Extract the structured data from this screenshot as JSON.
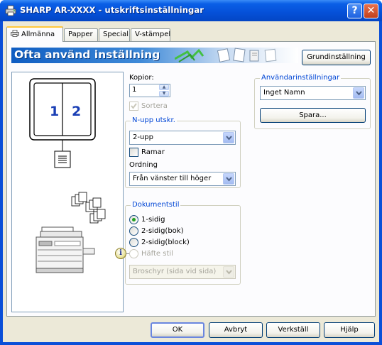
{
  "window": {
    "title": "SHARP AR-XXXX - utskriftsinställningar",
    "help_button": "?",
    "close_button": "✕"
  },
  "tabs": [
    {
      "label": "Allmänna",
      "active": true
    },
    {
      "label": "Papper",
      "active": false
    },
    {
      "label": "Special",
      "active": false
    },
    {
      "label": "V-stämpel",
      "active": false
    }
  ],
  "banner": {
    "title": "Ofta använd inställning"
  },
  "preview": {
    "page_numbers": [
      "1",
      "2"
    ]
  },
  "main": {
    "copies_label": "Kopior:",
    "copies_value": "1",
    "collate_label": "Sortera",
    "collate_checked": true,
    "collate_enabled": false
  },
  "nup": {
    "group_title": "N-upp utskr.",
    "selected": "2-upp",
    "border_label": "Ramar",
    "border_checked": false,
    "order_label": "Ordning",
    "order_selected": "Från vänster till höger"
  },
  "document_style": {
    "group_title": "Dokumentstil",
    "options": [
      {
        "label": "1-sidig",
        "selected": true,
        "enabled": true
      },
      {
        "label": "2-sidig(bok)",
        "selected": false,
        "enabled": true
      },
      {
        "label": "2-sidig(block)",
        "selected": false,
        "enabled": true
      },
      {
        "label": "Häfte stil",
        "selected": false,
        "enabled": false
      }
    ],
    "booklet_selected": "Broschyr (sida vid sida)"
  },
  "user_settings": {
    "defaults_button": "Grundinställning",
    "group_title": "Användarinställningar",
    "selected": "Inget Namn",
    "save_button": "Spara..."
  },
  "footer": {
    "ok": "OK",
    "cancel": "Avbryt",
    "apply": "Verkställ",
    "help": "Hjälp"
  },
  "colors": {
    "titlebar": "#0550d8",
    "dialog_bg": "#ece9d8",
    "group_title": "#0046d5",
    "banner_start": "#0f5dc2",
    "preview_digits": "#1a3fb5"
  }
}
